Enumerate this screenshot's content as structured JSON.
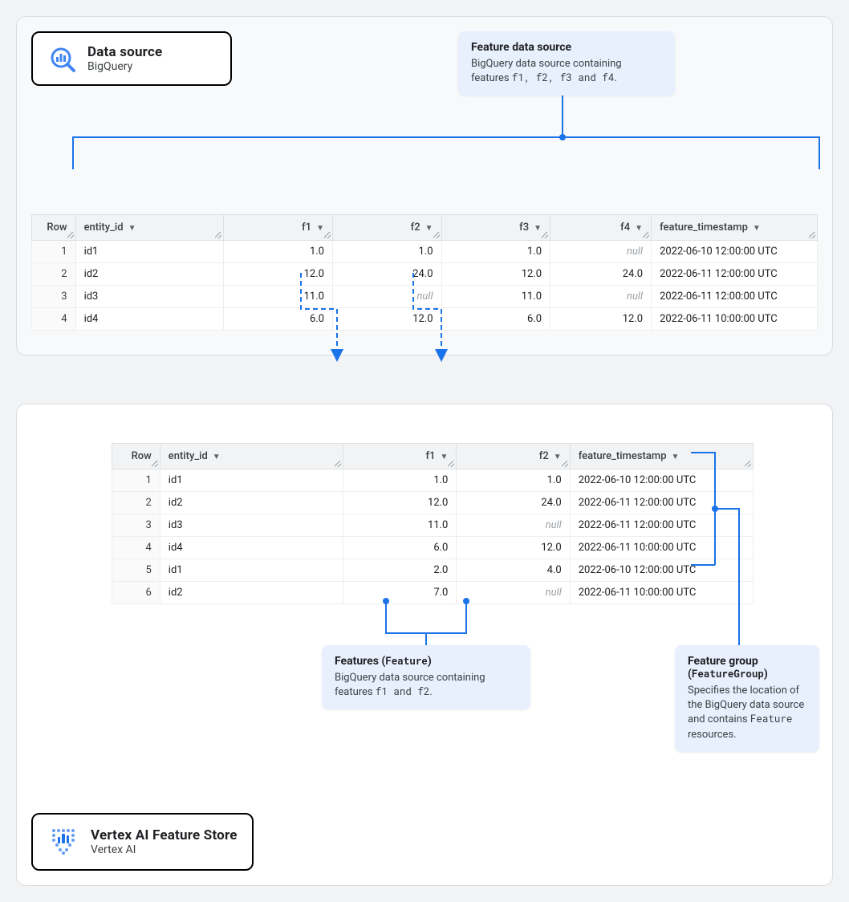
{
  "topCard": {
    "title": "Data source",
    "sub": "BigQuery"
  },
  "bottomCard": {
    "title": "Vertex AI Feature Store",
    "sub": "Vertex AI"
  },
  "callouts": {
    "featureDataSource": {
      "title": "Feature data source",
      "body_pre": "BigQuery data source containing features ",
      "body_codes": "f1, f2, f3 and f4",
      "body_post": "."
    },
    "features": {
      "title_pre": "Features (",
      "title_code": "Feature",
      "title_post": ")",
      "body_pre": "BigQuery data source containing features ",
      "body_codes": "f1 and f2",
      "body_post": "."
    },
    "featureGroup": {
      "title_pre": "Feature group (",
      "title_code": "FeatureGroup",
      "title_post": ")",
      "body_pre": "Specifies the location of the BigQuery data source and contains ",
      "body_code": "Feature",
      "body_post": " resources."
    }
  },
  "table1": {
    "columns": [
      "Row",
      "entity_id",
      "f1",
      "f2",
      "f3",
      "f4",
      "feature_timestamp"
    ],
    "rows": [
      {
        "n": "1",
        "entity_id": "id1",
        "f1": "1.0",
        "f2": "1.0",
        "f3": "1.0",
        "f4": "null",
        "ts": "2022-06-10 12:00:00 UTC"
      },
      {
        "n": "2",
        "entity_id": "id2",
        "f1": "12.0",
        "f2": "24.0",
        "f3": "12.0",
        "f4": "24.0",
        "ts": "2022-06-11 12:00:00 UTC"
      },
      {
        "n": "3",
        "entity_id": "id3",
        "f1": "11.0",
        "f2": "null",
        "f3": "11.0",
        "f4": "null",
        "ts": "2022-06-11 12:00:00 UTC"
      },
      {
        "n": "4",
        "entity_id": "id4",
        "f1": "6.0",
        "f2": "12.0",
        "f3": "6.0",
        "f4": "12.0",
        "ts": "2022-06-11 10:00:00 UTC"
      }
    ]
  },
  "table2": {
    "columns": [
      "Row",
      "entity_id",
      "f1",
      "f2",
      "feature_timestamp"
    ],
    "rows": [
      {
        "n": "1",
        "entity_id": "id1",
        "f1": "1.0",
        "f2": "1.0",
        "ts": "2022-06-10 12:00:00 UTC"
      },
      {
        "n": "2",
        "entity_id": "id2",
        "f1": "12.0",
        "f2": "24.0",
        "ts": "2022-06-11 12:00:00 UTC"
      },
      {
        "n": "3",
        "entity_id": "id3",
        "f1": "11.0",
        "f2": "null",
        "ts": "2022-06-11 12:00:00 UTC"
      },
      {
        "n": "4",
        "entity_id": "id4",
        "f1": "6.0",
        "f2": "12.0",
        "ts": "2022-06-11 10:00:00 UTC"
      },
      {
        "n": "5",
        "entity_id": "id1",
        "f1": "2.0",
        "f2": "4.0",
        "ts": "2022-06-10 12:00:00 UTC"
      },
      {
        "n": "6",
        "entity_id": "id2",
        "f1": "7.0",
        "f2": "null",
        "ts": "2022-06-11 10:00:00 UTC"
      }
    ]
  }
}
